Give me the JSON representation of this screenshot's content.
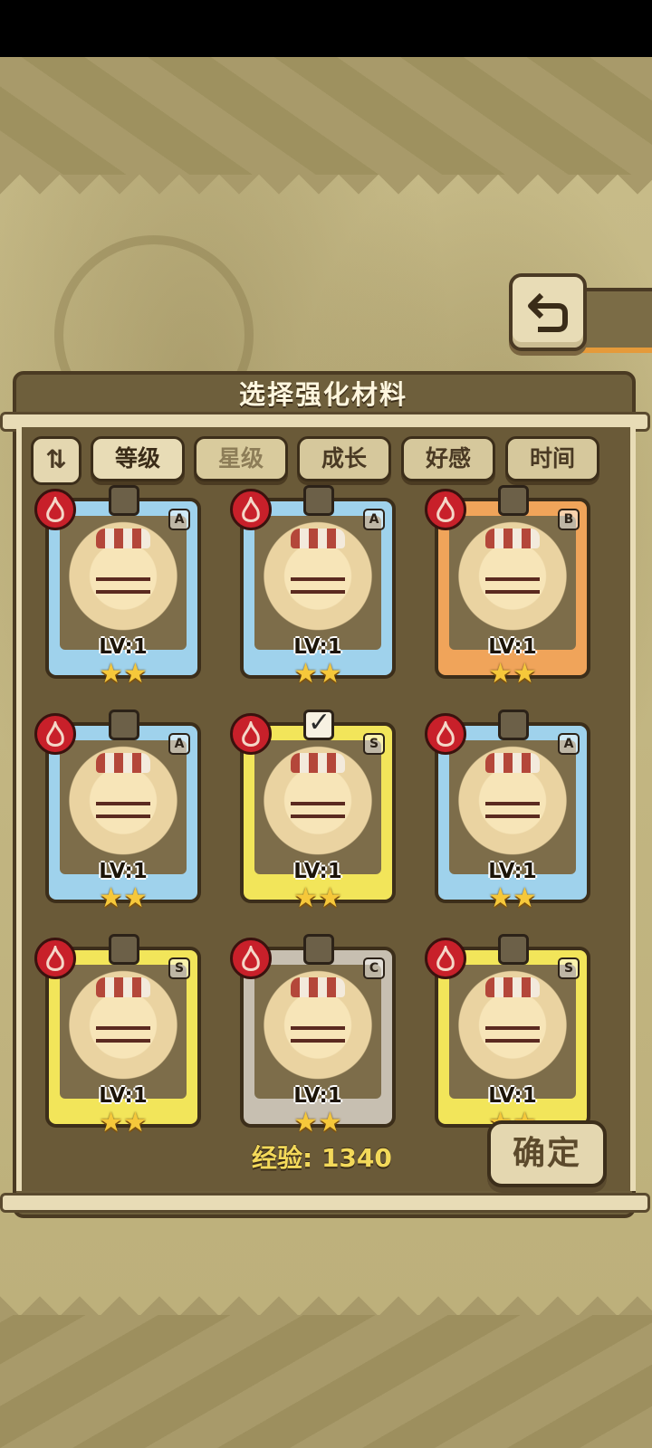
{
  "header": {
    "title": "选择强化材料",
    "back_icon": "return-arrow-icon"
  },
  "sort_bar": {
    "toggle_icon": "sort-order-icon",
    "toggle_label": "⇅",
    "tabs": [
      {
        "label": "等级",
        "active": true
      },
      {
        "label": "星级",
        "active": false
      },
      {
        "label": "成长",
        "active": false
      },
      {
        "label": "好感",
        "active": false
      },
      {
        "label": "时间",
        "active": false
      }
    ]
  },
  "cards": [
    {
      "grade": "A",
      "level": "LV:1",
      "stars": 2,
      "element": "fire",
      "selected": false,
      "frame_color": "#9fd2ec"
    },
    {
      "grade": "A",
      "level": "LV:1",
      "stars": 2,
      "element": "fire",
      "selected": false,
      "frame_color": "#9fd2ec"
    },
    {
      "grade": "B",
      "level": "LV:1",
      "stars": 2,
      "element": "fire",
      "selected": false,
      "frame_color": "#f0a45a"
    },
    {
      "grade": "A",
      "level": "LV:1",
      "stars": 2,
      "element": "fire",
      "selected": false,
      "frame_color": "#9fd2ec"
    },
    {
      "grade": "S",
      "level": "LV:1",
      "stars": 2,
      "element": "fire",
      "selected": true,
      "frame_color": "#f2e55a"
    },
    {
      "grade": "A",
      "level": "LV:1",
      "stars": 2,
      "element": "fire",
      "selected": false,
      "frame_color": "#9fd2ec"
    },
    {
      "grade": "S",
      "level": "LV:1",
      "stars": 2,
      "element": "fire",
      "selected": false,
      "frame_color": "#f2e55a"
    },
    {
      "grade": "C",
      "level": "LV:1",
      "stars": 2,
      "element": "fire",
      "selected": false,
      "frame_color": "#c7bfb1"
    },
    {
      "grade": "S",
      "level": "LV:1",
      "stars": 2,
      "element": "fire",
      "selected": false,
      "frame_color": "#f2e55a"
    }
  ],
  "footer": {
    "exp_label": "经验:",
    "exp_value": "1340",
    "confirm_label": "确定"
  }
}
